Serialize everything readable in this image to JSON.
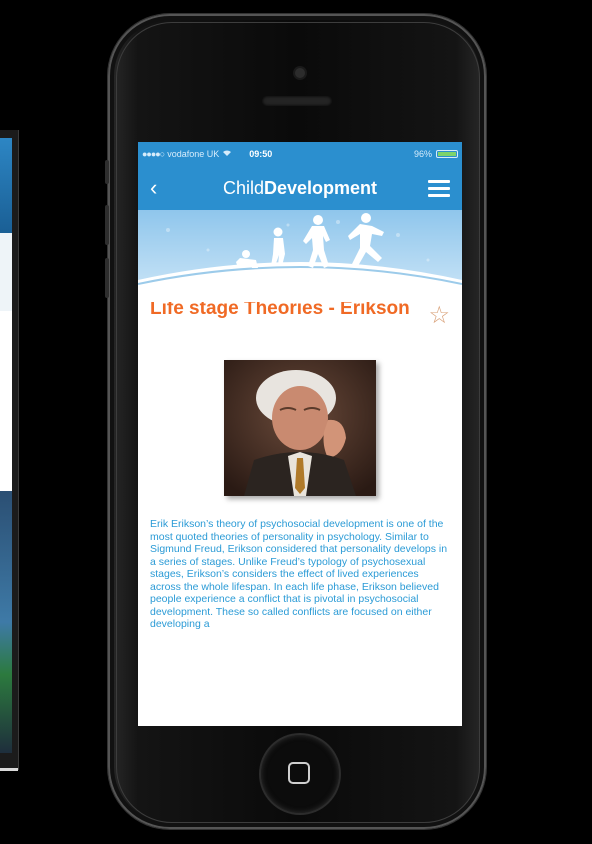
{
  "status_bar": {
    "carrier": "vodafone UK",
    "time": "09:50",
    "battery": "96%"
  },
  "nav": {
    "back_icon": "chevron-left-icon",
    "title_light": "Child",
    "title_bold": "Development",
    "menu_icon": "hamburger-icon"
  },
  "article": {
    "title": "Life stage Theories - Erikson",
    "favorite_icon": "star-outline-icon",
    "body": "Erik Erikson’s theory of psychosocial development is one of the most quoted theories of personality in psychology. Similar to Sigmund Freud, Erikson considered that personality develops in a series of stages. Unlike Freud’s typology of psychosexual stages, Erikson’s considers the effect of lived experiences across the whole lifespan. In each life phase, Erikson believed people experience a conflict that is pivotal in psychosocial development. These so called conflicts are focused on either developing a"
  },
  "colors": {
    "brand_blue": "#2b8fcf",
    "title_orange": "#f06a25",
    "body_blue": "#2b9bd6"
  }
}
